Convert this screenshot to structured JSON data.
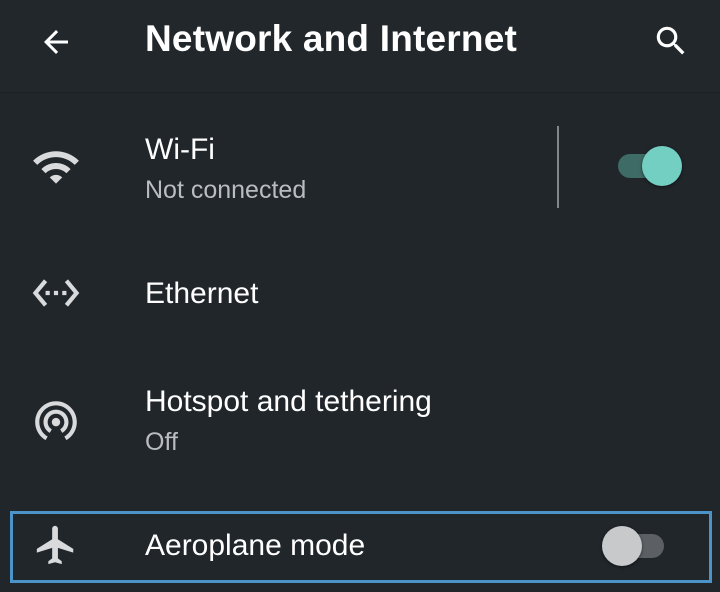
{
  "header": {
    "title": "Network and Internet",
    "back_icon": "arrow-back-icon",
    "search_icon": "search-icon"
  },
  "items": [
    {
      "id": "wifi",
      "icon": "wifi-icon",
      "title": "Wi-Fi",
      "subtitle": "Not connected",
      "toggle": {
        "on": true
      }
    },
    {
      "id": "ethernet",
      "icon": "ethernet-icon",
      "title": "Ethernet"
    },
    {
      "id": "hotspot",
      "icon": "hotspot-icon",
      "title": "Hotspot and tethering",
      "subtitle": "Off"
    },
    {
      "id": "aeroplane",
      "icon": "airplane-icon",
      "title": "Aeroplane mode",
      "toggle": {
        "on": false
      },
      "highlighted": true
    }
  ],
  "colors": {
    "background": "#21262b",
    "accent": "#74cfc3",
    "highlight_border": "#4b93c8"
  }
}
